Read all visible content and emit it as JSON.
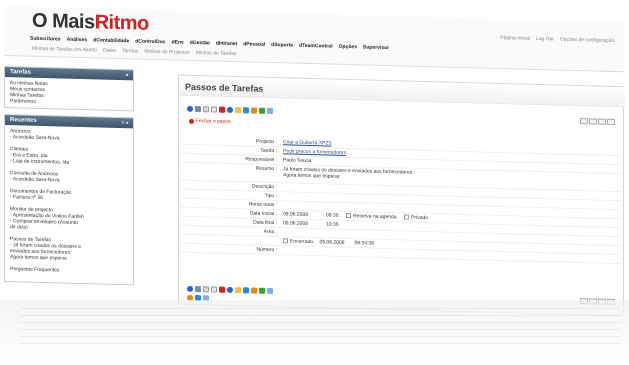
{
  "header": {
    "logo_prefix": "O",
    "logo_main": "Mais",
    "logo_accent": "Ritmo",
    "nav_primary": [
      "Subscritores",
      "Análises",
      "dContabilidade",
      "dControlDoc",
      "dEnv",
      "dGestão",
      "dIntranet",
      "dPessoal",
      "dSuporte",
      "dTeamControl",
      "Opções",
      "Supervisor"
    ],
    "nav_secondary": [
      "Minhas de Tarefas em Aberto",
      "Datas",
      "Tarefas",
      "Minhas de Projectos",
      "Minhas de Tarefas"
    ],
    "top_links": [
      "Página Inicial",
      "Log Out",
      "Opções de configuração"
    ]
  },
  "sidebar": {
    "tarefas": {
      "title": "Tarefas",
      "items": [
        "As minhas Notas",
        "Meus contactos",
        "Minhas Tarefas",
        "Parâmetros"
      ]
    },
    "recentes": {
      "title": "Recentes",
      "groups": [
        {
          "title": "Anúncios",
          "lines": [
            "- Acordeão Sara-Nova"
          ]
        },
        {
          "title": "Clientes",
          "lines": [
            "- Era e Estro, lda",
            "- Loja de Instrumentos, lda"
          ]
        },
        {
          "title": "Consulta de Anúncios",
          "lines": [
            "- Acordeão Sara-Nova"
          ]
        },
        {
          "title": "Documentos de Facturação",
          "lines": [
            "- Factura nº 36"
          ]
        },
        {
          "title": "Monitor de projecto",
          "lines": [
            "- Apresentação do Violino Fanfeh",
            "- Comprar envelopes (Assunto",
            "de dois)"
          ]
        },
        {
          "title": "Passos de Tarefas",
          "lines": [
            "- Já foram criados os dossiers e",
            "enviados aos fornecedores.",
            "Agora temos que esperar."
          ]
        },
        {
          "title": "Perguntas Frequentes",
          "lines": []
        }
      ]
    }
  },
  "main": {
    "title": "Passos de Tarefas",
    "close_label": "Fechar o passo",
    "fields": {
      "projecto": {
        "label": "Projecto :",
        "value": "Criar a Guitarra XPZ5"
      },
      "tarefa": {
        "label": "Tarefa :",
        "value": "Pedir precos a fornecedores"
      },
      "responsavel": {
        "label": "Responsável :",
        "value": "Paulo Sousa"
      },
      "resumo": {
        "label": "Resumo :",
        "value_line1": "Já foram criados os dossiers e enviados aos fornecedores.",
        "value_line2": "Agora temos que esperar."
      },
      "descricao": {
        "label": "Descrição :",
        "value": ""
      },
      "tipo": {
        "label": "Tipo :",
        "value": ""
      },
      "horas": {
        "label": "Horas reais :",
        "value": ""
      },
      "inicio": {
        "label": "Data inicial :",
        "date": "09.06.2008",
        "time": "09:30",
        "chk1": "Reserva na agenda",
        "chk2": "Privado"
      },
      "final": {
        "label": "Data final :",
        "date": "09.06.2008",
        "time": "10:30"
      },
      "area": {
        "label": "Área :",
        "value": ""
      },
      "encerrado": {
        "chk": "Encerrado",
        "date": "09.06.2008",
        "time": "09:54:38"
      },
      "numero": {
        "label": "Número :",
        "value": ""
      }
    }
  },
  "colors": {
    "brand_red": "#d42222",
    "panel_head": "#4a6179",
    "link": "#2a4c8c"
  }
}
